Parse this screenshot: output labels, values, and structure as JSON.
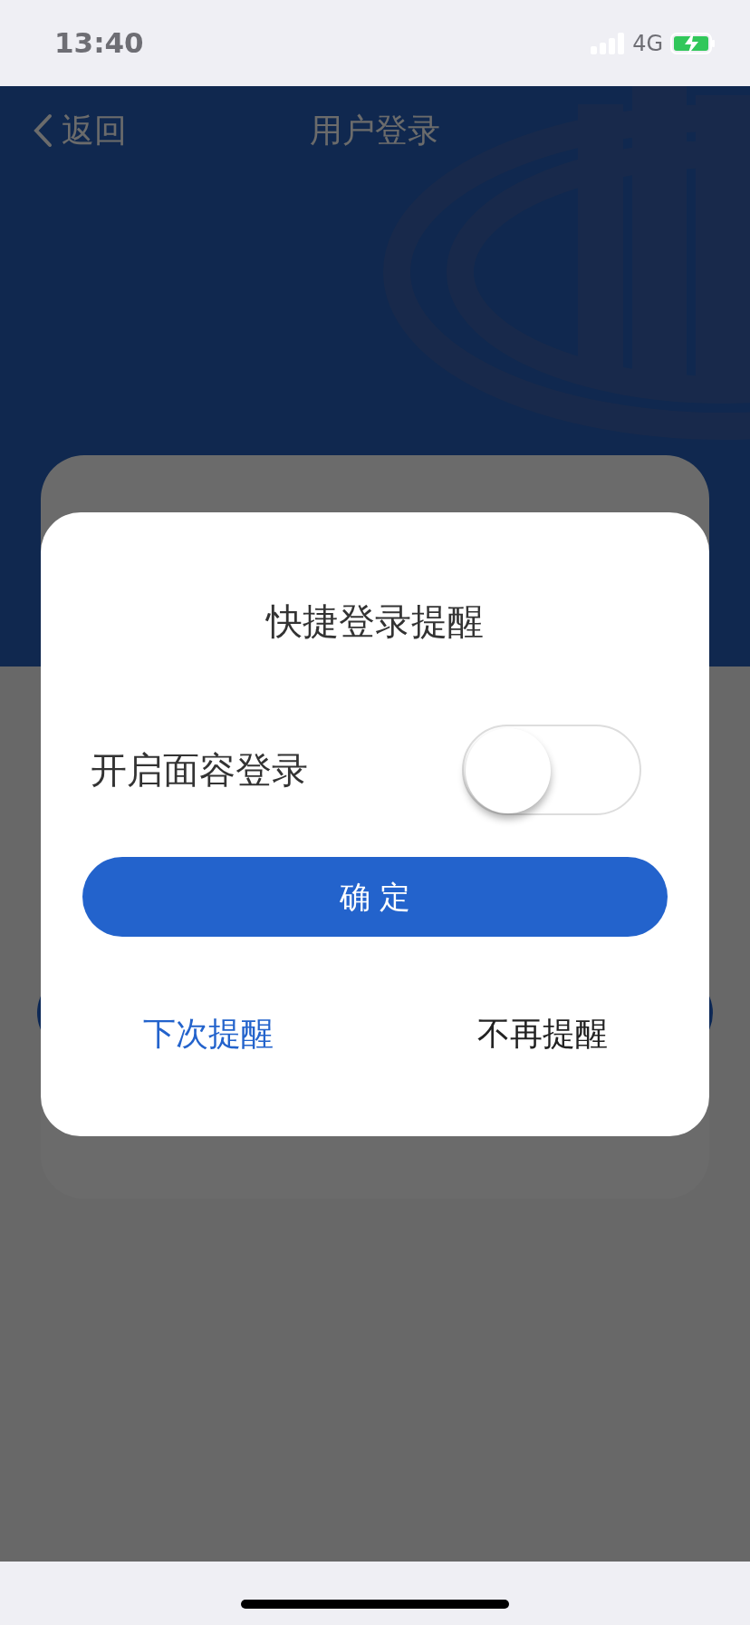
{
  "status_bar": {
    "time": "13:40",
    "network": "4G"
  },
  "header": {
    "back": "返回",
    "title": "用户登录"
  },
  "dialog": {
    "title": "快捷登录提醒",
    "toggle": {
      "label": "开启面容登录",
      "on": false
    },
    "confirm": "确 定",
    "actions": [
      {
        "label": "下次提醒",
        "kind": "primary"
      },
      {
        "label": "不再提醒",
        "kind": "plain"
      }
    ]
  }
}
